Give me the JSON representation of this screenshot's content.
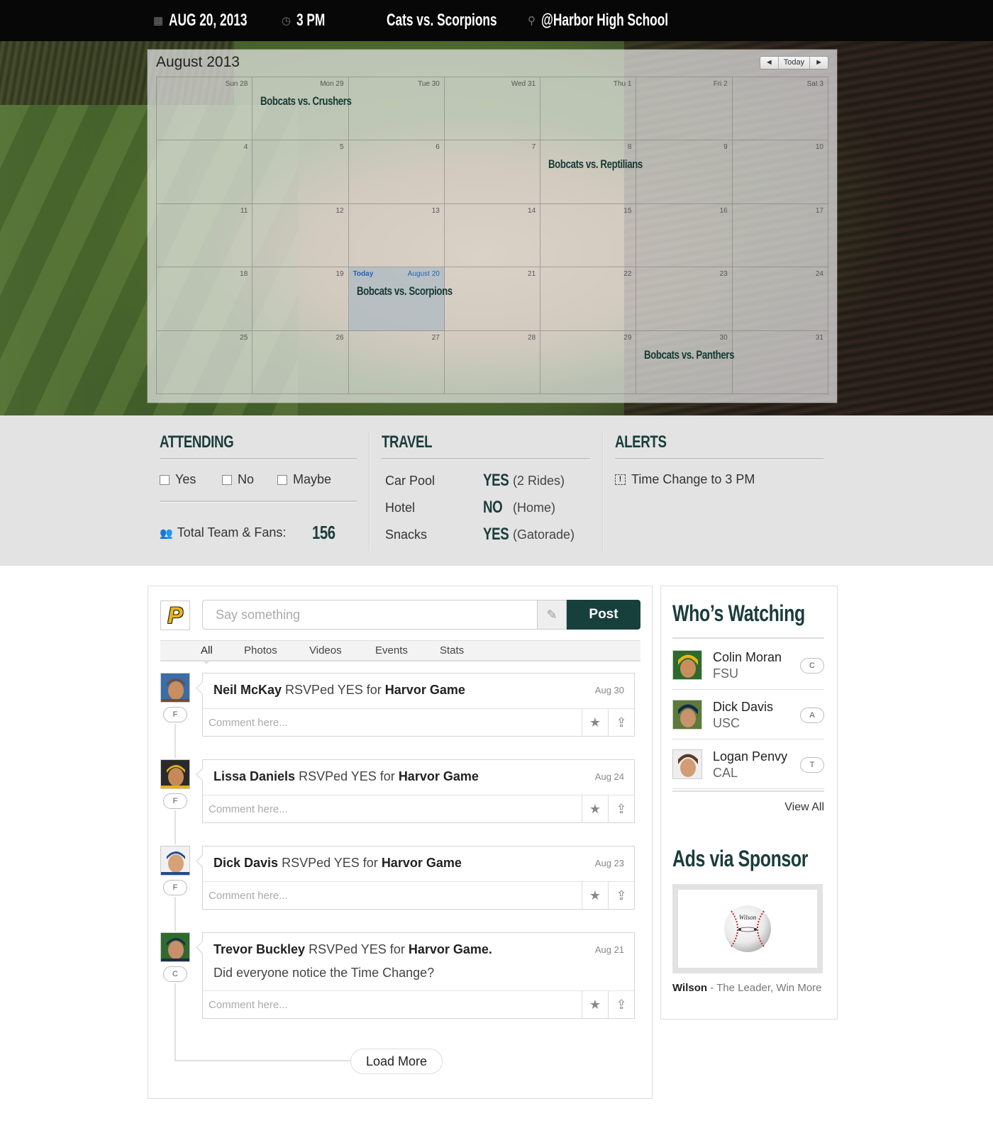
{
  "topbar": {
    "date": "AUG 20, 2013",
    "time": "3 PM",
    "matchup": "Cats vs. Scorpions",
    "location": "@Harbor High School"
  },
  "calendar": {
    "title": "August 2013",
    "nav": {
      "prev": "◄",
      "today": "Today",
      "next": "►"
    },
    "today_label": "Today",
    "weeks": [
      [
        {
          "day": "Sun 28",
          "event": ""
        },
        {
          "day": "Mon 29",
          "event": "Bobcats vs. Crushers"
        },
        {
          "day": "Tue 30",
          "event": ""
        },
        {
          "day": "Wed 31",
          "event": ""
        },
        {
          "day": "Thu 1",
          "event": ""
        },
        {
          "day": "Fri 2",
          "event": ""
        },
        {
          "day": "Sat 3",
          "event": ""
        }
      ],
      [
        {
          "day": "4",
          "event": ""
        },
        {
          "day": "5",
          "event": ""
        },
        {
          "day": "6",
          "event": ""
        },
        {
          "day": "7",
          "event": ""
        },
        {
          "day": "8",
          "event": "Bobcats vs. Reptilians"
        },
        {
          "day": "9",
          "event": ""
        },
        {
          "day": "10",
          "event": ""
        }
      ],
      [
        {
          "day": "11",
          "event": ""
        },
        {
          "day": "12",
          "event": ""
        },
        {
          "day": "13",
          "event": ""
        },
        {
          "day": "14",
          "event": ""
        },
        {
          "day": "15",
          "event": ""
        },
        {
          "day": "16",
          "event": ""
        },
        {
          "day": "17",
          "event": ""
        }
      ],
      [
        {
          "day": "18",
          "event": ""
        },
        {
          "day": "19",
          "event": ""
        },
        {
          "day": "August 20",
          "event": "Bobcats vs. Scorpions",
          "today": true
        },
        {
          "day": "21",
          "event": ""
        },
        {
          "day": "22",
          "event": ""
        },
        {
          "day": "23",
          "event": ""
        },
        {
          "day": "24",
          "event": ""
        }
      ],
      [
        {
          "day": "25",
          "event": ""
        },
        {
          "day": "26",
          "event": ""
        },
        {
          "day": "27",
          "event": ""
        },
        {
          "day": "28",
          "event": ""
        },
        {
          "day": "29",
          "event": ""
        },
        {
          "day": "30",
          "event": "Bobcats vs. Panthers"
        },
        {
          "day": "31",
          "event": ""
        }
      ]
    ]
  },
  "attending": {
    "title": "ATTENDING",
    "options": [
      "Yes",
      "No",
      "Maybe"
    ],
    "total_label": "Total Team & Fans:",
    "total_value": "156"
  },
  "travel": {
    "title": "TRAVEL",
    "rows": [
      {
        "label": "Car Pool",
        "value": "YES",
        "note": "(2 Rides)"
      },
      {
        "label": "Hotel",
        "value": "NO",
        "note": "(Home)"
      },
      {
        "label": "Snacks",
        "value": "YES",
        "note": "(Gatorade)"
      }
    ]
  },
  "alerts": {
    "title": "ALERTS",
    "items": [
      "Time Change to 3 PM"
    ]
  },
  "composer": {
    "logo_letter": "P",
    "placeholder": "Say something",
    "post_label": "Post"
  },
  "feed_tabs": [
    "All",
    "Photos",
    "Videos",
    "Events",
    "Stats"
  ],
  "posts": [
    {
      "name": "Neil McKay",
      "action": " RSVPed YES for ",
      "target": "Harvor Game",
      "suffix": "",
      "date": "Aug 30",
      "role": "F",
      "body": "",
      "comment_placeholder": "Comment here..."
    },
    {
      "name": "Lissa Daniels",
      "action": " RSVPed YES for ",
      "target": "Harvor Game",
      "suffix": "",
      "date": "Aug 24",
      "role": "F",
      "body": "",
      "comment_placeholder": "Comment here..."
    },
    {
      "name": "Dick Davis",
      "action": " RSVPed YES for ",
      "target": "Harvor Game",
      "suffix": "",
      "date": "Aug 23",
      "role": "F",
      "body": "",
      "comment_placeholder": "Comment here..."
    },
    {
      "name": "Trevor Buckley",
      "action": " RSVPed YES for ",
      "target": "Harvor Game",
      "suffix": ".",
      "date": "Aug 21",
      "role": "C",
      "body": "Did everyone notice the Time Change?",
      "comment_placeholder": "Comment here..."
    }
  ],
  "load_more": "Load More",
  "watching": {
    "title": "Who’s Watching",
    "people": [
      {
        "name": "Colin Moran",
        "school": "FSU",
        "badge": "C"
      },
      {
        "name": "Dick Davis",
        "school": "USC",
        "badge": "A"
      },
      {
        "name": "Logan Penvy",
        "school": "CAL",
        "badge": "T"
      }
    ],
    "view_all": "View All"
  },
  "ads": {
    "title": "Ads via Sponsor",
    "brand": "Wilson",
    "tagline": " - The Leader, Win More",
    "ball_text": "Wilson"
  },
  "colors": {
    "accent": "#17403d",
    "today_blue": "#1f63b8"
  }
}
